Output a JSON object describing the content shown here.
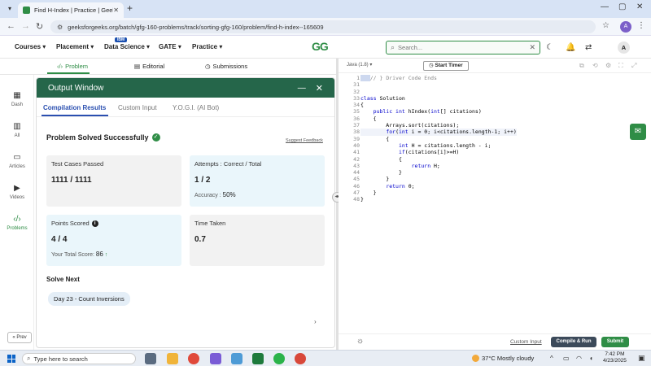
{
  "browser": {
    "tab_title": "Find H-Index | Practice | GeeksforGeeks",
    "url": "geeksforgeeks.org/batch/gfg-160-problems/track/sorting-gfg-160/problem/find-h-index--165609",
    "profile_initial": "A"
  },
  "header": {
    "menu": [
      "Courses",
      "Placement",
      "Data Science",
      "GATE",
      "Practice"
    ],
    "ibm_badge": "IBM",
    "logo": "GG",
    "search_placeholder": "Search...",
    "avatar": "A"
  },
  "problem_tabs": [
    "Problem",
    "Editorial",
    "Submissions"
  ],
  "sidebar": {
    "items": [
      "Dash",
      "All",
      "Articles",
      "Videos",
      "Problems"
    ],
    "prev_label": "« Prev"
  },
  "output": {
    "title": "Output Window",
    "tabs": [
      "Compilation Results",
      "Custom Input",
      "Y.O.G.I. (AI Bot)"
    ],
    "status": "Problem Solved Successfully",
    "feedback": "Suggest Feedback",
    "cards": {
      "tests_label": "Test Cases Passed",
      "tests_value": "1111 / 1111",
      "attempts_label": "Attempts : Correct / Total",
      "attempts_value": "1 / 2",
      "accuracy_label": "Accuracy :",
      "accuracy_value": "50%",
      "points_label": "Points Scored",
      "points_value": "4 / 4",
      "total_label": "Your Total Score:",
      "total_value": "86",
      "time_label": "Time Taken",
      "time_value": "0.7"
    },
    "solve_next_title": "Solve Next",
    "solve_next_item": "Day 23 - Count Inversions"
  },
  "editor": {
    "language": "Java (1.8)",
    "timer_label": "Start Timer",
    "line_numbers": [
      "1",
      "31",
      "32",
      "33",
      "34",
      "35",
      "36",
      "37",
      "38",
      "39",
      "40",
      "41",
      "42",
      "43",
      "44",
      "45",
      "46",
      "47",
      "48"
    ],
    "custom_input": "Custom Input",
    "compile_run": "Compile & Run",
    "submit": "Submit"
  },
  "taskbar": {
    "search_placeholder": "Type here to search",
    "weather": "37°C  Mostly cloudy",
    "time": "7:42 PM",
    "date": "4/23/2025"
  },
  "colors": {
    "gfg_green": "#2f8d46",
    "output_header": "#25664a",
    "accent_blue": "#2a4fb0"
  }
}
